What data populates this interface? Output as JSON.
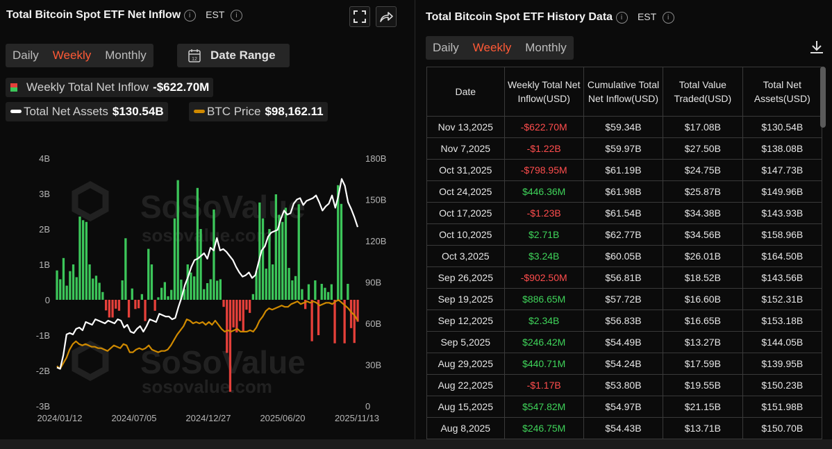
{
  "left_panel": {
    "title": "Total Bitcoin Spot ETF Net Inflow",
    "timezone": "EST",
    "period_tabs": [
      "Daily",
      "Weekly",
      "Monthly"
    ],
    "selected_tab": "Weekly",
    "date_range_label": "Date Range",
    "legend": {
      "inflow_label": "Weekly Total Net Inflow",
      "inflow_value": "-$622.70M",
      "assets_label": "Total Net Assets",
      "assets_value": "$130.54B",
      "btc_label": "BTC Price",
      "btc_value": "$98,162.11"
    },
    "watermark": "SoSoValue",
    "watermark_url": "sosovalue.com"
  },
  "chart_data": {
    "type": "bar",
    "x_tick_labels": [
      "2024/01/12",
      "2024/07/05",
      "2024/12/27",
      "2025/06/20",
      "2025/11/13"
    ],
    "left_axis": {
      "ticks": [
        "4B",
        "3B",
        "2B",
        "1B",
        "0",
        "-1B",
        "-2B",
        "-3B"
      ],
      "ylim": [
        -3,
        4
      ]
    },
    "right_axis": {
      "ticks": [
        "180B",
        "150B",
        "120B",
        "90B",
        "60B",
        "30B",
        "0"
      ],
      "ylim": [
        0,
        180
      ]
    },
    "colors": {
      "positive": "#3cc65a",
      "negative": "#e5403a",
      "assets": "#ffffff",
      "btc": "#d08a00"
    },
    "series": [
      {
        "name": "Weekly Total Net Inflow",
        "axis": "left",
        "values": [
          0.83,
          0.58,
          1.18,
          0.4,
          0.81,
          1.0,
          0.64,
          2.35,
          2.25,
          2.2,
          1.0,
          0.6,
          0.68,
          0.48,
          0.22,
          -0.3,
          -0.5,
          -0.5,
          -0.25,
          -0.31,
          0.55,
          1.74,
          -0.5,
          0.32,
          -0.26,
          -0.24,
          0.16,
          -0.6,
          1.44,
          1.0,
          -0.31,
          0.07,
          0.34,
          0.5,
          0.1,
          0.28,
          2.3,
          3.38,
          0.57,
          0.3,
          1.0,
          0.77,
          0.66,
          3.16,
          2.0,
          0.3,
          0.47,
          0.58,
          2.55,
          0.54,
          0.58,
          -0.2,
          -1.5,
          -2.6,
          -0.78,
          -0.92,
          -0.6,
          -0.9,
          -0.28,
          -0.37,
          0.16,
          0.81,
          2.75,
          2.3,
          0.88,
          2.0,
          1.0,
          2.98,
          2.4,
          2.2,
          2.6,
          0.9,
          0.55,
          0.67,
          2.7,
          0.3,
          -0.26,
          0.44,
          -1.17,
          0.55,
          -1.0,
          0.45,
          0.34,
          0.22,
          0.44,
          -1.23,
          3.24,
          2.71,
          -1.23,
          0.45,
          -0.8,
          -1.22,
          -0.62
        ]
      },
      {
        "name": "Total Net Assets",
        "axis": "right",
        "values": [
          28,
          27,
          37,
          52,
          53,
          52,
          56,
          57,
          55,
          61,
          60,
          59,
          63,
          62,
          61,
          60,
          62,
          61,
          60,
          63,
          62,
          57,
          59,
          54,
          53,
          56,
          58,
          54,
          58,
          63,
          62,
          61,
          67,
          66,
          65,
          65,
          63,
          64,
          72,
          79,
          88,
          94,
          101,
          106,
          107,
          109,
          111,
          107,
          115,
          113,
          122,
          113,
          114,
          112,
          109,
          106,
          101,
          97,
          94,
          95,
          97,
          93,
          95,
          104,
          113,
          116,
          123,
          126,
          127,
          128,
          136,
          142,
          139,
          140,
          147,
          150,
          151,
          146,
          149,
          150,
          151,
          153,
          148,
          142,
          145,
          147,
          153,
          144,
          153,
          165,
          160,
          148,
          143,
          137,
          130
        ]
      },
      {
        "name": "BTC Price",
        "axis": "right",
        "values": [
          29,
          27,
          31,
          35,
          41,
          45,
          47,
          45,
          44,
          45,
          44,
          43,
          43,
          42,
          42,
          41,
          40,
          42,
          44,
          43,
          42,
          45,
          44,
          39,
          39,
          41,
          42,
          41,
          42,
          44,
          41,
          40,
          39,
          40,
          40,
          41,
          44,
          48,
          52,
          55,
          58,
          63,
          62,
          60,
          61,
          60,
          61,
          59,
          61,
          59,
          62,
          59,
          56,
          54,
          55,
          54,
          55,
          56,
          54,
          54,
          54,
          55,
          54,
          57,
          62,
          65,
          69,
          71,
          70,
          71,
          72,
          73,
          72,
          72,
          74,
          75,
          76,
          74,
          75,
          76,
          75,
          76,
          75,
          73,
          74,
          75,
          75,
          74,
          76,
          77,
          75,
          73,
          71,
          68,
          66,
          62
        ]
      }
    ]
  },
  "right_panel": {
    "title": "Total Bitcoin Spot ETF History Data",
    "timezone": "EST",
    "period_tabs": [
      "Daily",
      "Weekly",
      "Monthly"
    ],
    "selected_tab": "Weekly",
    "columns": [
      "Date",
      "Weekly Total Net Inflow(USD)",
      "Cumulative Total Net Inflow(USD)",
      "Total Value Traded(USD)",
      "Total Net Assets(USD)"
    ],
    "rows": [
      [
        "Nov 13,2025",
        "-$622.70M",
        "$59.34B",
        "$17.08B",
        "$130.54B"
      ],
      [
        "Nov 7,2025",
        "-$1.22B",
        "$59.97B",
        "$27.50B",
        "$138.08B"
      ],
      [
        "Oct 31,2025",
        "-$798.95M",
        "$61.19B",
        "$24.75B",
        "$147.73B"
      ],
      [
        "Oct 24,2025",
        "$446.36M",
        "$61.98B",
        "$25.87B",
        "$149.96B"
      ],
      [
        "Oct 17,2025",
        "-$1.23B",
        "$61.54B",
        "$34.38B",
        "$143.93B"
      ],
      [
        "Oct 10,2025",
        "$2.71B",
        "$62.77B",
        "$34.56B",
        "$158.96B"
      ],
      [
        "Oct 3,2025",
        "$3.24B",
        "$60.05B",
        "$26.01B",
        "$164.50B"
      ],
      [
        "Sep 26,2025",
        "-$902.50M",
        "$56.81B",
        "$18.52B",
        "$143.56B"
      ],
      [
        "Sep 19,2025",
        "$886.65M",
        "$57.72B",
        "$16.60B",
        "$152.31B"
      ],
      [
        "Sep 12,2025",
        "$2.34B",
        "$56.83B",
        "$16.65B",
        "$153.18B"
      ],
      [
        "Sep 5,2025",
        "$246.42M",
        "$54.49B",
        "$13.27B",
        "$144.05B"
      ],
      [
        "Aug 29,2025",
        "$440.71M",
        "$54.24B",
        "$17.59B",
        "$139.95B"
      ],
      [
        "Aug 22,2025",
        "-$1.17B",
        "$53.80B",
        "$19.55B",
        "$150.23B"
      ],
      [
        "Aug 15,2025",
        "$547.82M",
        "$54.97B",
        "$21.15B",
        "$151.98B"
      ],
      [
        "Aug 8,2025",
        "$246.75M",
        "$54.43B",
        "$13.71B",
        "$150.70B"
      ]
    ]
  }
}
